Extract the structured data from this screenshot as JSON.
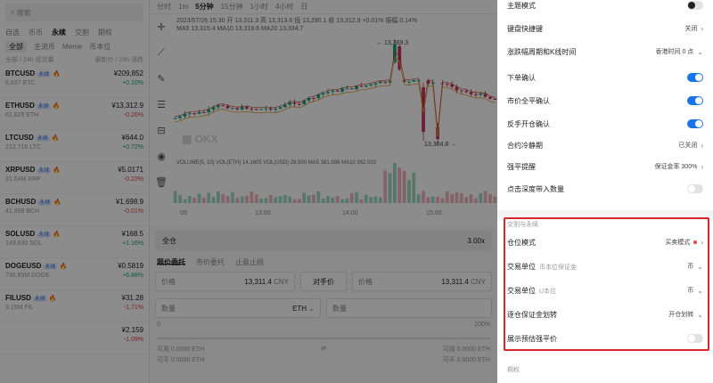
{
  "market": {
    "search_placeholder": "搜索",
    "tabs": [
      "自选",
      "币币",
      "永续",
      "交割",
      "期权"
    ],
    "active_tab": 2,
    "sub_tabs": [
      "全部",
      "主流币",
      "Meme",
      "币本位"
    ],
    "header": [
      "全部 / 24h 成交量",
      "最新价 / 24h 涨跌"
    ],
    "coins": [
      {
        "sym": "BTCUSD",
        "tag": "永续",
        "vol": "6,937 BTC",
        "price": "¥209,852",
        "chg": "+0.10%",
        "dir": "up"
      },
      {
        "sym": "ETHUSD",
        "tag": "永续",
        "vol": "61,829 ETH",
        "price": "¥13,312.9",
        "chg": "-0.26%",
        "dir": "dn"
      },
      {
        "sym": "LTCUSD",
        "tag": "永续",
        "vol": "212,716 LTC",
        "price": "¥644.0",
        "chg": "+0.72%",
        "dir": "up"
      },
      {
        "sym": "XRPUSD",
        "tag": "永续",
        "vol": "31.64M XRP",
        "price": "¥5.0171",
        "chg": "-0.23%",
        "dir": "dn"
      },
      {
        "sym": "BCHUSD",
        "tag": "永续",
        "vol": "42,999 BCH",
        "price": "¥1,698.9",
        "chg": "-0.01%",
        "dir": "dn"
      },
      {
        "sym": "SOLUSD",
        "tag": "永续",
        "vol": "149,630 SOL",
        "price": "¥168.5",
        "chg": "+1.16%",
        "dir": "up"
      },
      {
        "sym": "DOGEUSD",
        "tag": "永续",
        "vol": "730.85M DOGE",
        "price": "¥0.5819",
        "chg": "+6.88%",
        "dir": "up"
      },
      {
        "sym": "FILUSD",
        "tag": "永续",
        "vol": "3.15M FIL",
        "price": "¥31.28",
        "chg": "-1.71%",
        "dir": "dn"
      },
      {
        "sym": "",
        "tag": "",
        "vol": "",
        "price": "¥2.159",
        "chg": "-1.09%",
        "dir": "dn"
      }
    ]
  },
  "chart": {
    "intervals": [
      "分时",
      "1m",
      "5分钟",
      "15分钟",
      "1小时",
      "4小时",
      "日"
    ],
    "selected_interval": 2,
    "ohlc_line": "2023/07/26 15:30  开 13,311.3  高 13,313.6  低 13,290.1  收 13,312.9  +0.01%  振幅 0.14%",
    "ma_line": "MA5 13,315.4   MA10 13,319.6   MA20 13,334.7",
    "vol_line": "VOLUME(5, 10)  VOL(ETH) 14.1605  VOL(USD) 29,990  MA5 381.596  MA10 392.002",
    "high_label": "13,369.3",
    "low_label": "13,304.8",
    "watermark": "OKX",
    "time_labels": [
      "09",
      "13:00",
      "14:00",
      "15:00"
    ]
  },
  "order": {
    "bar_left": "全仓",
    "bar_right": "3.00x",
    "tabs": [
      "限价委托",
      "市价委托",
      "止盈止损"
    ],
    "price_label": "价格",
    "price_value": "13,311.4",
    "price_unit": "CNY",
    "opp_btn": "对手价",
    "price_value2": "13,311.4",
    "qty_label": "数量",
    "qty_unit": "ETH",
    "avail_left": "可用 0.0000 ETH",
    "avail_right": "可用 0.0000 ETH",
    "buy_left": "可平 0.0000 ETH",
    "buy_right": "可平 0.0000 ETH",
    "pct_0": "0",
    "pct_100": "100%"
  },
  "settings": {
    "rows_top": [
      {
        "label": "主题模式",
        "type": "toggle-dark"
      },
      {
        "label": "键盘快捷键",
        "value": "关闭",
        "type": "chevron"
      },
      {
        "label": "涨跌幅周期和K线时间",
        "value": "香港时间 0 点",
        "type": "dropdown"
      },
      {
        "label": "下单确认",
        "type": "toggle-on"
      },
      {
        "label": "市价全平确认",
        "type": "toggle-on"
      },
      {
        "label": "反手开仓确认",
        "type": "toggle-on"
      },
      {
        "label": "合约冷静期",
        "value": "已关闭",
        "type": "chevron"
      },
      {
        "label": "强平提醒",
        "value": "保证金率 300%",
        "type": "chevron"
      },
      {
        "label": "点击深度带入数量",
        "type": "toggle-off"
      }
    ],
    "section_title": "交割与永续",
    "rows_section": [
      {
        "label": "仓位模式",
        "sub": "",
        "value": "买卖模式",
        "type": "dot-chevron"
      },
      {
        "label": "交易单位",
        "sub": "币本位保证金",
        "value": "币",
        "type": "dropdown"
      },
      {
        "label": "交易单位",
        "sub": "U本位",
        "value": "币",
        "type": "dropdown"
      },
      {
        "label": "逐仓保证金划转",
        "sub": "",
        "value": "开仓划转",
        "type": "dropdown"
      },
      {
        "label": "展示预估强平价",
        "sub": "",
        "type": "toggle-off"
      }
    ],
    "section2_title": "期权"
  }
}
